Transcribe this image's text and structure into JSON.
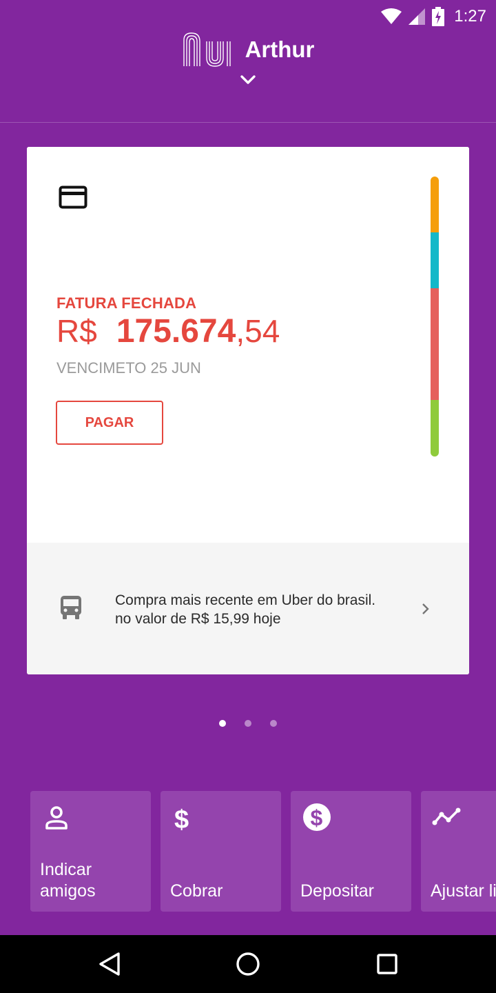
{
  "status_bar": {
    "time": "1:27"
  },
  "header": {
    "user_name": "Arthur"
  },
  "card": {
    "status_label": "FATURA FECHADA",
    "currency": "R$",
    "amount_integer": "175.674",
    "amount_cents": ",54",
    "due_label": "VENCIMETO 25 JUN",
    "pay_button": "PAGAR",
    "limit_bar_colors": [
      "#f59e0b",
      "#13b8c9",
      "#e5605c",
      "#8fcb3b"
    ],
    "recent_purchase": "Compra mais recente em Uber do brasil. no valor de R$ 15,99 hoje"
  },
  "pager": {
    "count": 3,
    "active": 0
  },
  "shortcuts": [
    {
      "label": "Indicar amigos",
      "icon": "person-icon"
    },
    {
      "label": "Cobrar",
      "icon": "dollar-icon"
    },
    {
      "label": "Depositar",
      "icon": "dollar-circle-icon"
    },
    {
      "label": "Ajustar limite",
      "icon": "trend-icon"
    }
  ],
  "colors": {
    "brand": "#82269e",
    "accent_red": "#e5473e",
    "tile": "#9444ad"
  }
}
